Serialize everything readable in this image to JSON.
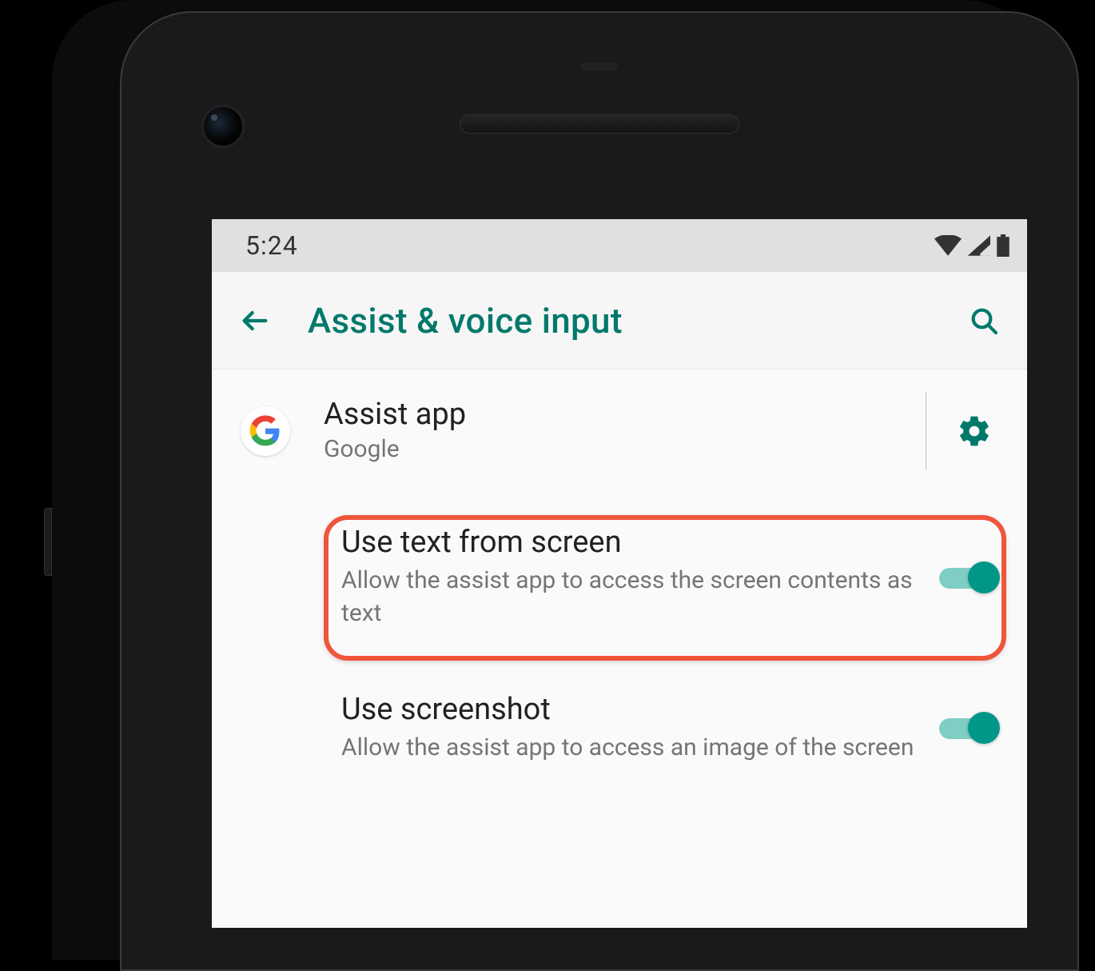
{
  "accent": "#00796b",
  "statusbar": {
    "time": "5:24"
  },
  "appbar": {
    "title": "Assist & voice input"
  },
  "rows": {
    "assist": {
      "title": "Assist app",
      "subtitle": "Google"
    },
    "useText": {
      "title": "Use text from screen",
      "subtitle": "Allow the assist app to access the screen contents as text",
      "on": true
    },
    "useScreenshot": {
      "title": "Use screenshot",
      "subtitle": "Allow the assist app to access an image of the screen",
      "on": true
    }
  }
}
